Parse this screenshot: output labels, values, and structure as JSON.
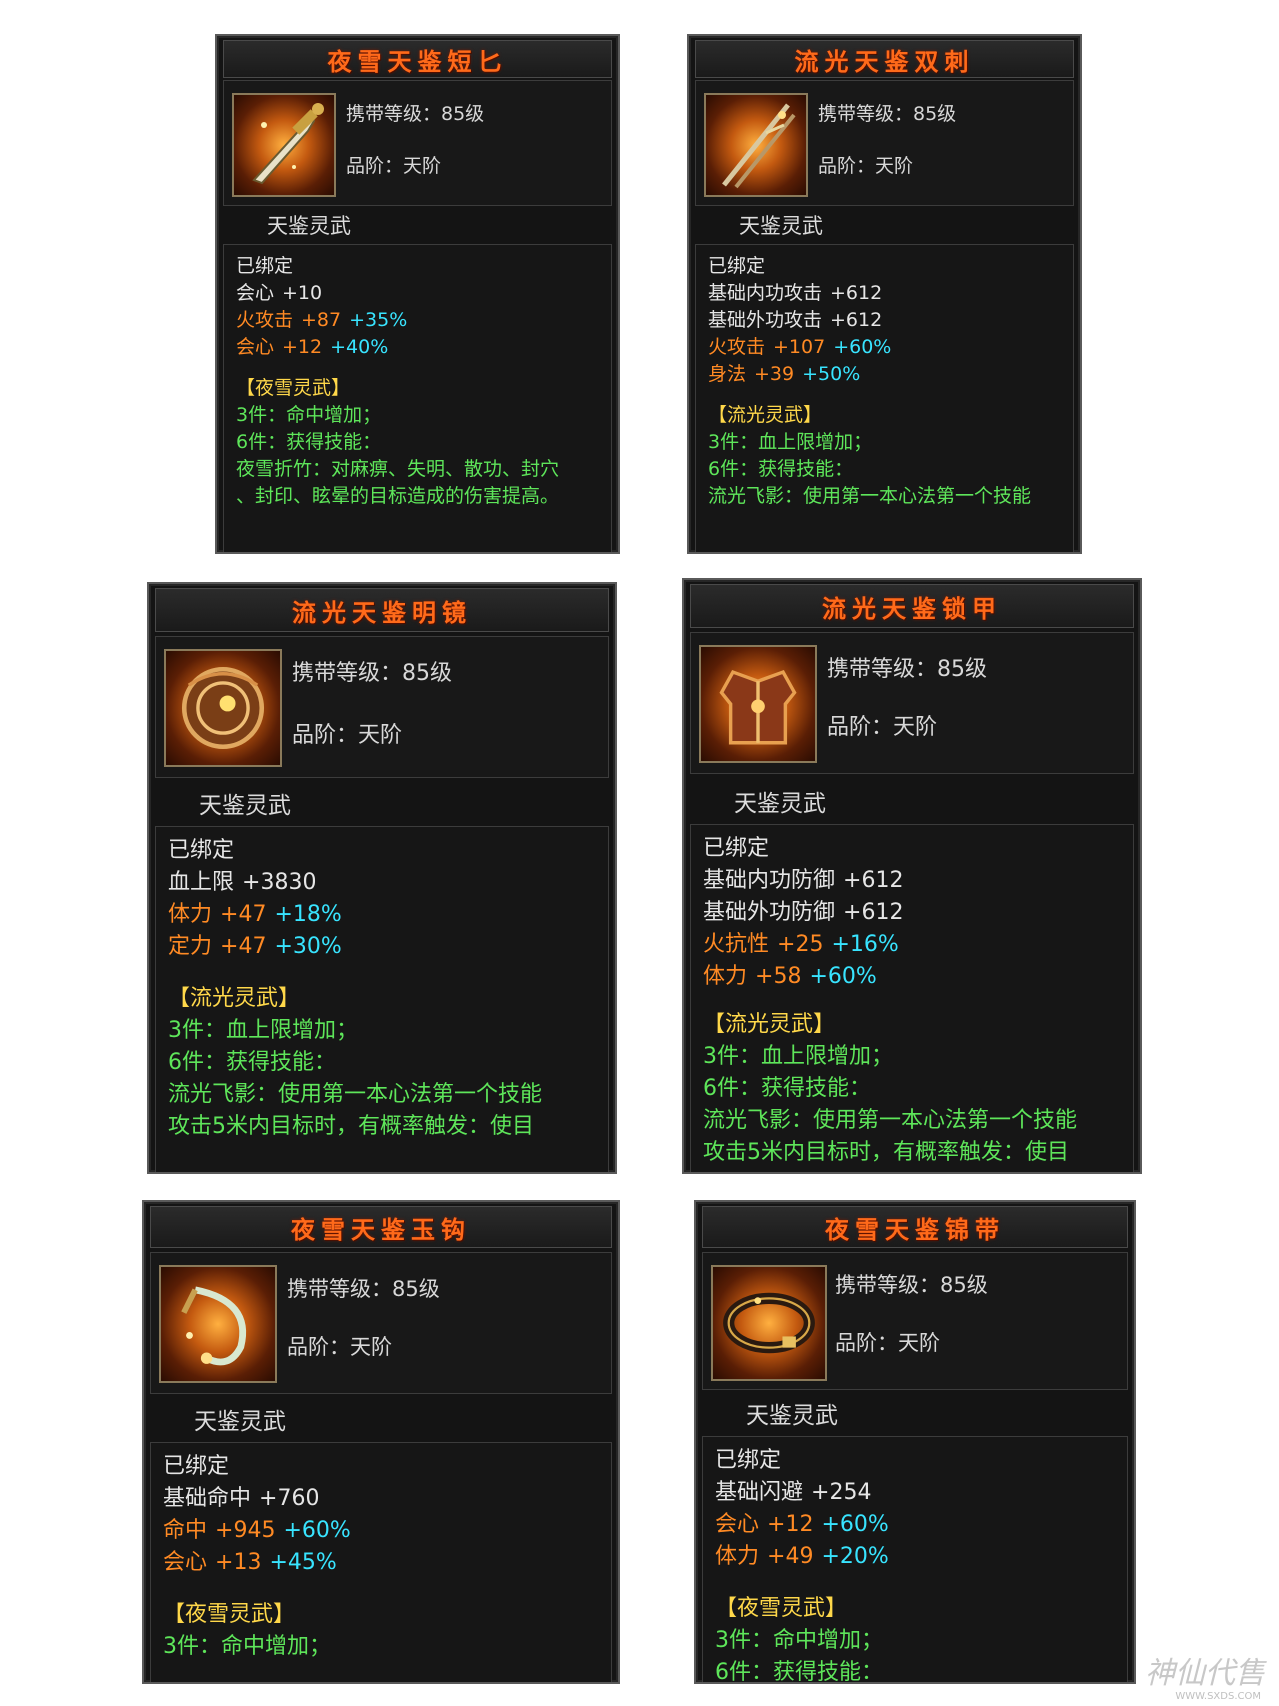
{
  "cards": [
    {
      "title": "夜雪天鉴短匕",
      "level": "携带等级：85级",
      "grade": "品阶：天阶",
      "subtitle": "天鉴灵武",
      "bound": "已绑定",
      "stats": [
        {
          "name": "会心",
          "value": "+10",
          "bonus": "",
          "color": "white"
        },
        {
          "name": "火攻击",
          "value": "+87",
          "bonus": "+35%",
          "color": "orange"
        },
        {
          "name": "会心",
          "value": "+12",
          "bonus": "+40%",
          "color": "orange"
        }
      ],
      "set_name": "【夜雪灵武】",
      "set_lines": [
        "3件：命中增加；",
        "6件：获得技能：",
        "夜雪折竹：对麻痹、失明、散功、封穴",
        "、封印、眩晕的目标造成的伤害提高。"
      ],
      "icon": "dagger-icon"
    },
    {
      "title": "流光天鉴双刺",
      "level": "携带等级：85级",
      "grade": "品阶：天阶",
      "subtitle": "天鉴灵武",
      "bound": "已绑定",
      "stats": [
        {
          "name": "基础内功攻击",
          "value": "+612",
          "bonus": "",
          "color": "white"
        },
        {
          "name": "基础外功攻击",
          "value": "+612",
          "bonus": "",
          "color": "white"
        },
        {
          "name": "火攻击",
          "value": "+107",
          "bonus": "+60%",
          "color": "orange"
        },
        {
          "name": "身法",
          "value": "+39",
          "bonus": "+50%",
          "color": "orange"
        }
      ],
      "set_name": "【流光灵武】",
      "set_lines": [
        "3件：血上限增加；",
        "6件：获得技能：",
        "流光飞影：使用第一本心法第一个技能"
      ],
      "icon": "twin-spike-icon"
    },
    {
      "title": "流光天鉴明镜",
      "level": "携带等级：85级",
      "grade": "品阶：天阶",
      "subtitle": "天鉴灵武",
      "bound": "已绑定",
      "stats": [
        {
          "name": "血上限",
          "value": "+3830",
          "bonus": "",
          "color": "white"
        },
        {
          "name": "体力",
          "value": "+47",
          "bonus": "+18%",
          "color": "orange"
        },
        {
          "name": "定力",
          "value": "+47",
          "bonus": "+30%",
          "color": "orange"
        }
      ],
      "set_name": "【流光灵武】",
      "set_lines": [
        "3件：血上限增加；",
        "6件：获得技能：",
        "流光飞影：使用第一本心法第一个技能",
        "攻击5米内目标时，有概率触发：使目"
      ],
      "icon": "mirror-icon"
    },
    {
      "title": "流光天鉴锁甲",
      "level": "携带等级：85级",
      "grade": "品阶：天阶",
      "subtitle": "天鉴灵武",
      "bound": "已绑定",
      "stats": [
        {
          "name": "基础内功防御",
          "value": "+612",
          "bonus": "",
          "color": "white"
        },
        {
          "name": "基础外功防御",
          "value": "+612",
          "bonus": "",
          "color": "white"
        },
        {
          "name": "火抗性",
          "value": "+25",
          "bonus": "+16%",
          "color": "orange"
        },
        {
          "name": "体力",
          "value": "+58",
          "bonus": "+60%",
          "color": "orange"
        }
      ],
      "set_name": "【流光灵武】",
      "set_lines": [
        "3件：血上限增加；",
        "6件：获得技能：",
        "流光飞影：使用第一本心法第一个技能",
        "攻击5米内目标时，有概率触发：使目"
      ],
      "icon": "armor-icon"
    },
    {
      "title": "夜雪天鉴玉钩",
      "level": "携带等级：85级",
      "grade": "品阶：天阶",
      "subtitle": "天鉴灵武",
      "bound": "已绑定",
      "stats": [
        {
          "name": "基础命中",
          "value": "+760",
          "bonus": "",
          "color": "white"
        },
        {
          "name": "命中",
          "value": "+945",
          "bonus": "+60%",
          "color": "orange"
        },
        {
          "name": "会心",
          "value": "+13",
          "bonus": "+45%",
          "color": "orange"
        }
      ],
      "set_name": "【夜雪灵武】",
      "set_lines": [
        "3件：命中增加；"
      ],
      "icon": "hook-icon"
    },
    {
      "title": "夜雪天鉴锦带",
      "level": "携带等级：85级",
      "grade": "品阶：天阶",
      "subtitle": "天鉴灵武",
      "bound": "已绑定",
      "stats": [
        {
          "name": "基础闪避",
          "value": "+254",
          "bonus": "",
          "color": "white"
        },
        {
          "name": "会心",
          "value": "+12",
          "bonus": "+60%",
          "color": "orange"
        },
        {
          "name": "体力",
          "value": "+49",
          "bonus": "+20%",
          "color": "orange"
        }
      ],
      "set_name": "【夜雪灵武】",
      "set_lines": [
        "3件：命中增加；",
        "6件：获得技能："
      ],
      "icon": "belt-icon"
    }
  ],
  "watermark": {
    "text": "神仙代售",
    "url": "WWW.SXDS.COM"
  }
}
